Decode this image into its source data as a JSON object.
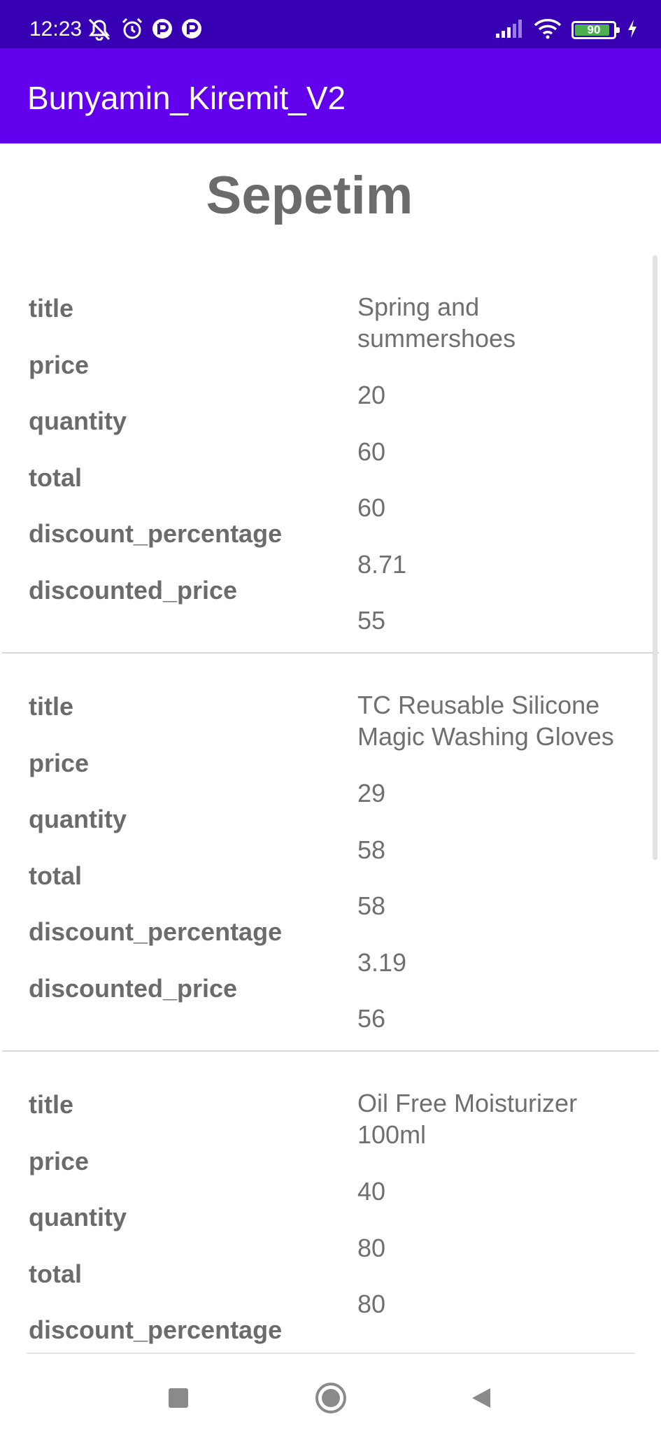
{
  "status_bar": {
    "time": "12:23",
    "battery_level": "90",
    "battery_fraction": 0.9,
    "icons_left": [
      "notifications-muted-icon",
      "alarm-icon",
      "app-notification-icon",
      "app-notification-icon"
    ],
    "icons_right": [
      "signal-icon",
      "wifi-icon",
      "battery-icon",
      "charging-icon"
    ]
  },
  "app_bar": {
    "title": "Bunyamin_Kiremit_V2",
    "color": "#6200ee",
    "status_color": "#3700b3"
  },
  "page": {
    "title": "Sepetim"
  },
  "labels": {
    "title": "title",
    "price": "price",
    "quantity": "quantity",
    "total": "total",
    "discount_percentage": "discount_percentage",
    "discounted_price": "discounted_price"
  },
  "items": [
    {
      "title": "Spring and summershoes",
      "price": "20",
      "quantity": "60",
      "total": "60",
      "discount_percentage": "8.71",
      "discounted_price": "55"
    },
    {
      "title": "TC Reusable Silicone Magic Washing Gloves",
      "price": "29",
      "quantity": "58",
      "total": "58",
      "discount_percentage": "3.19",
      "discounted_price": "56"
    },
    {
      "title": "Oil Free Moisturizer 100ml",
      "price": "40",
      "quantity": "80",
      "total": "80"
    }
  ],
  "nav_bar": {
    "buttons": [
      "recents-icon",
      "home-icon",
      "back-icon"
    ]
  }
}
